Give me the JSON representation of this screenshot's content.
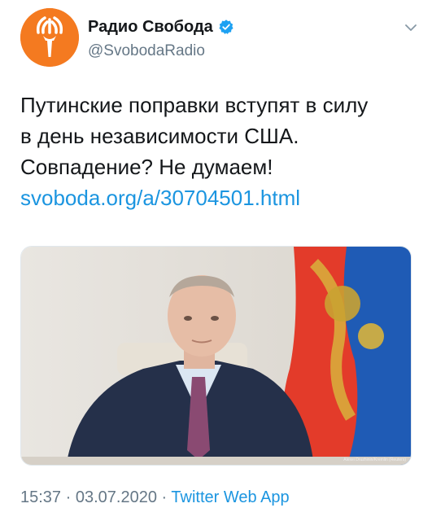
{
  "account": {
    "display_name": "Радио Свобода",
    "handle": "@SvobodaRadio",
    "verified": true,
    "avatar_icon": "rferl-torch-logo",
    "avatar_color": "#f47a20"
  },
  "tweet": {
    "lines": [
      "Путинские поправки вступят в силу",
      "в день независимости США.",
      "Совпадение? Не думаем!"
    ],
    "link": "svoboda.org/a/30704501.html"
  },
  "media": {
    "photo_credit": "Alexei Druzhinin/Kremlin (Reuters)"
  },
  "meta": {
    "time": "15:37",
    "separator": "·",
    "date": "03.07.2020",
    "source": "Twitter Web App"
  },
  "colors": {
    "link": "#1b95e0",
    "secondary_text": "#657786",
    "verified_badge": "#1da1f2"
  }
}
